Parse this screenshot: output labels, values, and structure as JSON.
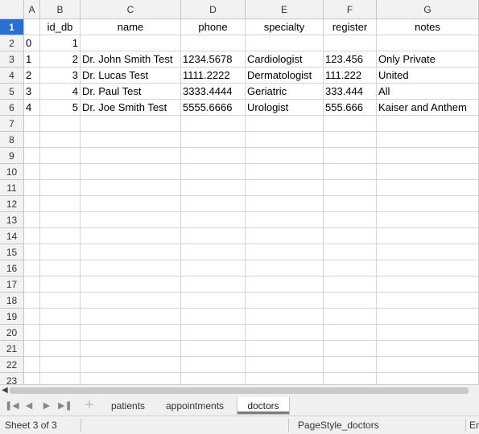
{
  "columns": [
    "A",
    "B",
    "C",
    "D",
    "E",
    "F",
    "G"
  ],
  "row_numbers": [
    "1",
    "2",
    "3",
    "4",
    "5",
    "6",
    "7",
    "8",
    "9",
    "10",
    "11",
    "12",
    "13",
    "14",
    "15",
    "16",
    "17",
    "18",
    "19",
    "20",
    "21",
    "22",
    "23"
  ],
  "active_row": "1",
  "sheet": {
    "header_row": [
      "",
      "id_db",
      "name",
      "phone",
      "specialty",
      "register",
      "notes"
    ],
    "rows": [
      [
        "0",
        "1",
        "",
        "",
        "",
        "",
        ""
      ],
      [
        "1",
        "2",
        "Dr. John Smith Test",
        "1234.5678",
        "Cardiologist",
        "123.456",
        "Only Private"
      ],
      [
        "2",
        "3",
        "Dr. Lucas Test",
        "1111.2222",
        "Dermatologist",
        "111.222",
        "United"
      ],
      [
        "3",
        "4",
        "Dr. Paul Test",
        "3333.4444",
        "Geriatric",
        "333.444",
        "All"
      ],
      [
        "4",
        "5",
        "Dr. Joe Smith Test",
        "5555.6666",
        "Urologist",
        "555.666",
        "Kaiser and Anthem"
      ]
    ]
  },
  "tabs": [
    "patients",
    "appointments",
    "doctors"
  ],
  "active_tab": "doctors",
  "nav_buttons": [
    "first-sheet",
    "previous-sheet",
    "next-sheet",
    "last-sheet"
  ],
  "add_sheet_icon": "plus-icon",
  "status": {
    "sheet_info": "Sheet 3 of 3",
    "page_style": "PageStyle_doctors",
    "language": "En"
  },
  "colors": {
    "active_row_header": "#2a6fcf",
    "header_bg": "#f2f2f2",
    "gridline": "#d4d4d4"
  }
}
